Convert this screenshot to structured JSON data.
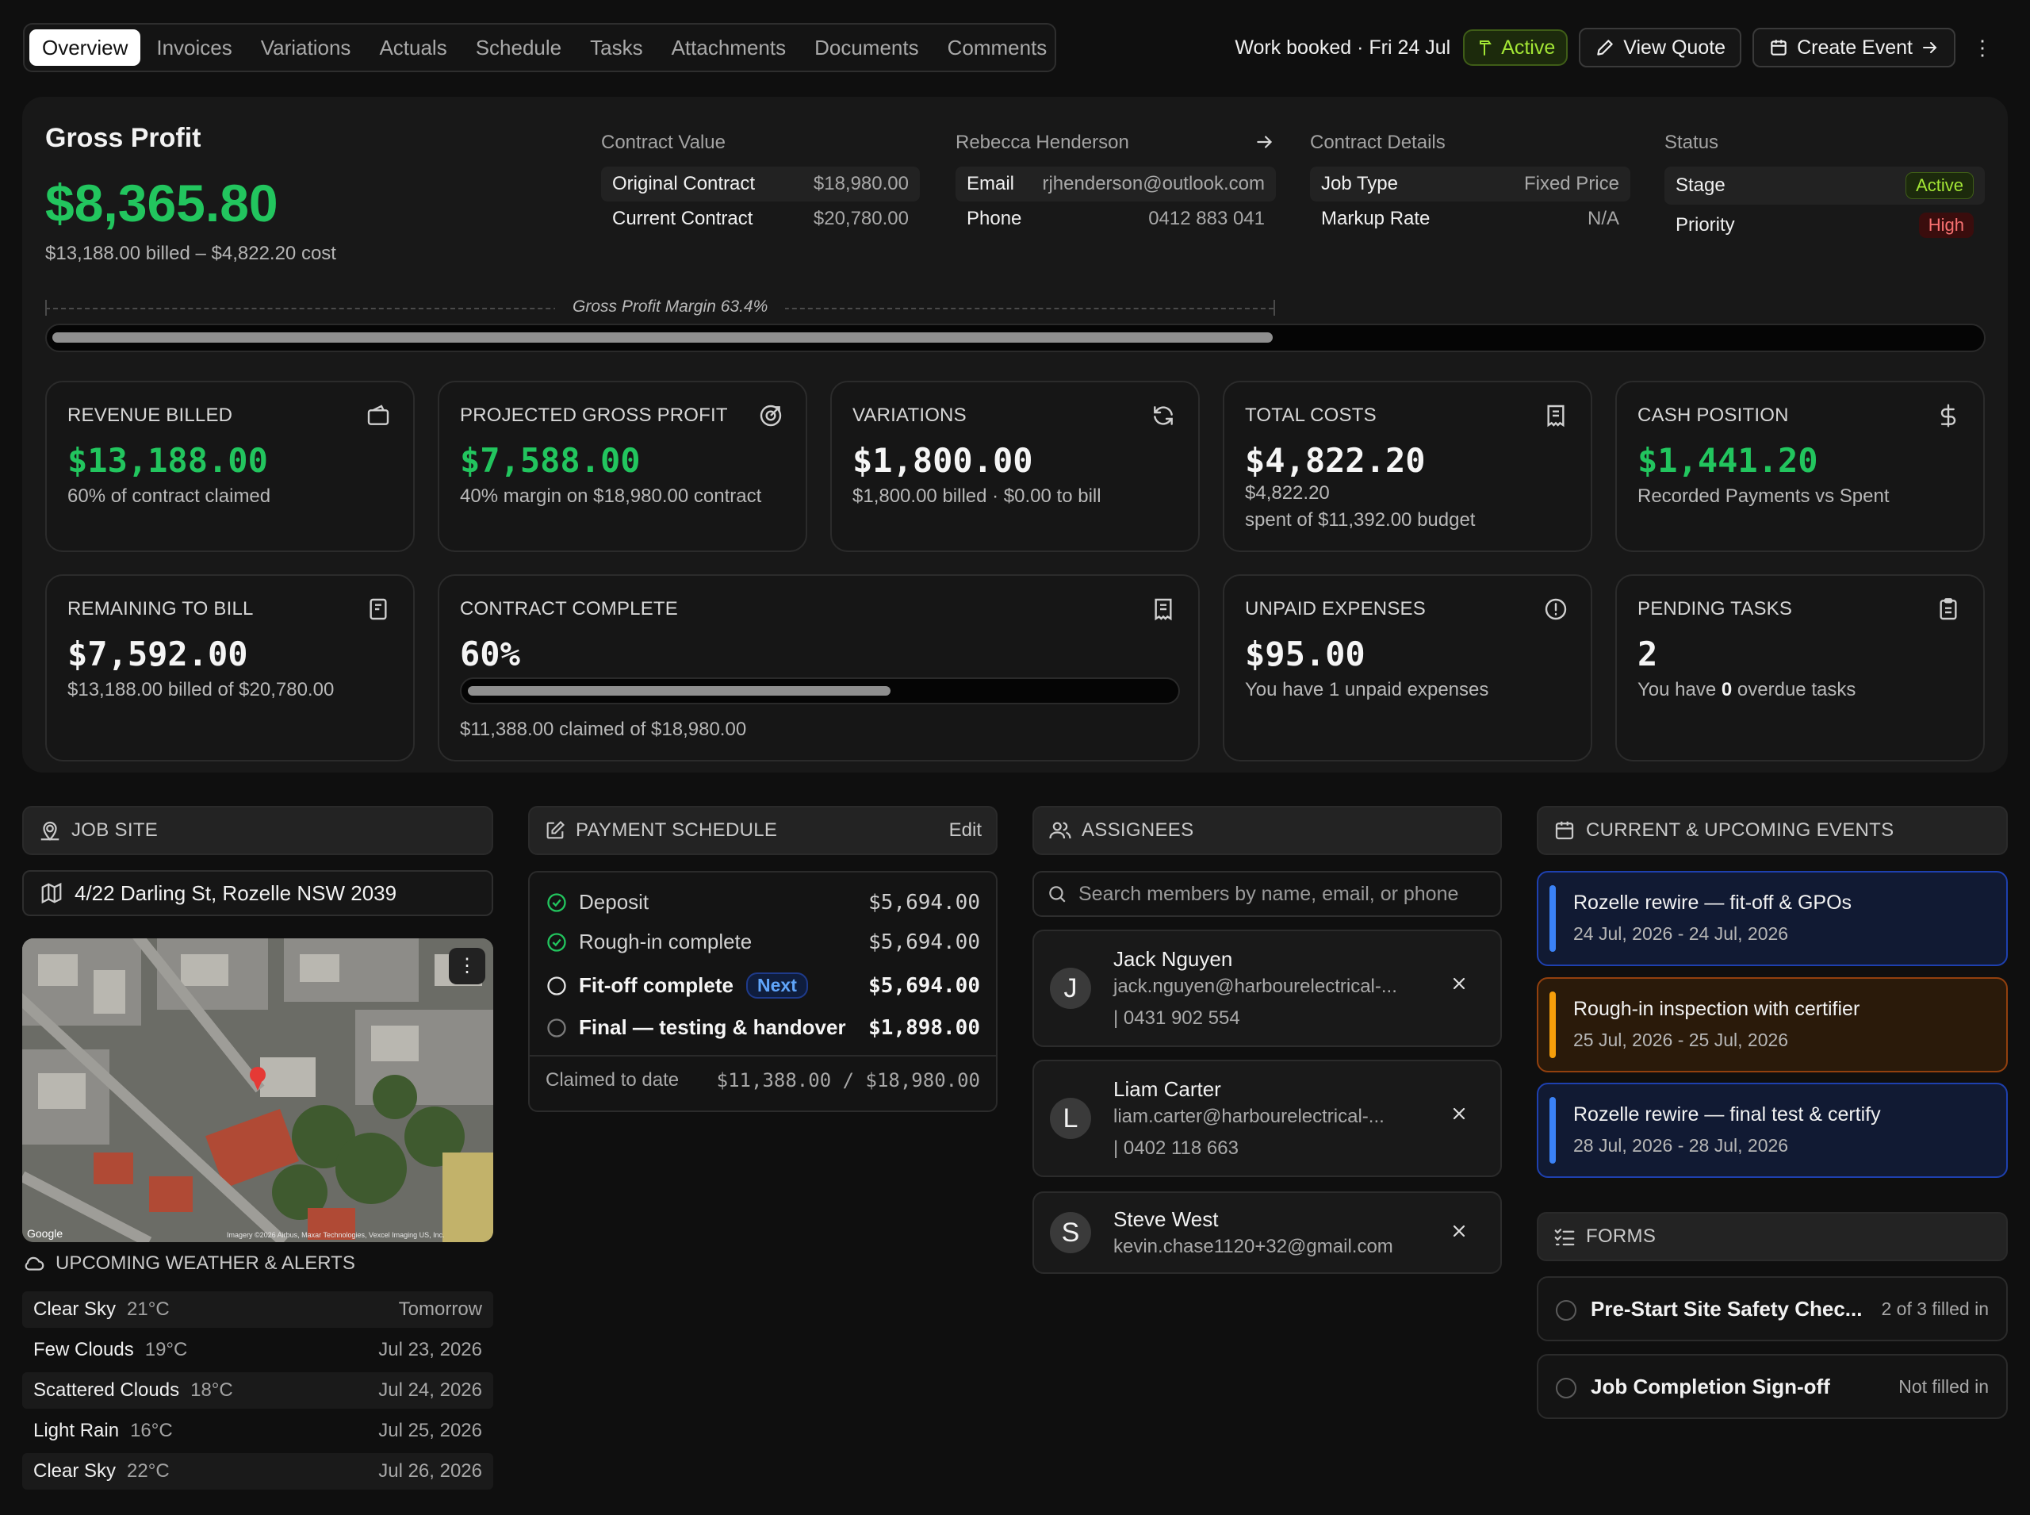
{
  "tabs": [
    "Overview",
    "Invoices",
    "Variations",
    "Actuals",
    "Schedule",
    "Tasks",
    "Attachments",
    "Documents",
    "Comments"
  ],
  "header": {
    "work_booked": "Work booked · Fri 24 Jul",
    "status": "Active",
    "view_quote": "View Quote",
    "create_event": "Create Event",
    "more": "⋮"
  },
  "gross_profit": {
    "title": "Gross Profit",
    "amount": "$8,365.80",
    "sub": "$13,188.00 billed – $4,822.20 cost",
    "margin_label": "Gross Profit Margin 63.4%",
    "margin_fraction": 0.634
  },
  "contract_value": {
    "title": "Contract Value",
    "rows": [
      {
        "k": "Original Contract",
        "v": "$18,980.00"
      },
      {
        "k": "Current Contract",
        "v": "$20,780.00"
      }
    ]
  },
  "client": {
    "name": "Rebecca Henderson",
    "rows": [
      {
        "k": "Email",
        "v": "rjhenderson@outlook.com"
      },
      {
        "k": "Phone",
        "v": "0412 883 041"
      }
    ]
  },
  "contract_details": {
    "title": "Contract Details",
    "rows": [
      {
        "k": "Job Type",
        "v": "Fixed Price"
      },
      {
        "k": "Markup Rate",
        "v": "N/A"
      }
    ]
  },
  "status_block": {
    "title": "Status",
    "stage_label": "Stage",
    "stage": "Active",
    "priority_label": "Priority",
    "priority": "High"
  },
  "stats": {
    "revenue_billed": {
      "label": "REVENUE BILLED",
      "value": "$13,188.00",
      "desc": "60% of contract claimed"
    },
    "projected_gp": {
      "label": "PROJECTED GROSS PROFIT",
      "value": "$7,588.00",
      "desc": "40% margin on $18,980.00 contract"
    },
    "variations": {
      "label": "VARIATIONS",
      "value": "$1,800.00",
      "desc": "$1,800.00 billed · $0.00 to bill"
    },
    "total_costs": {
      "label": "TOTAL COSTS",
      "value": "$4,822.20",
      "sub": "$4,822.20",
      "desc": "spent of $11,392.00 budget"
    },
    "cash_position": {
      "label": "CASH POSITION",
      "value": "$1,441.20",
      "desc": "Recorded Payments vs Spent"
    },
    "remaining": {
      "label": "REMAINING TO BILL",
      "value": "$7,592.00",
      "desc": "$13,188.00 billed of $20,780.00"
    },
    "contract_complete": {
      "label": "CONTRACT COMPLETE",
      "value": "60%",
      "fraction": 0.6,
      "desc": "$11,388.00 claimed of $18,980.00"
    },
    "unpaid": {
      "label": "UNPAID EXPENSES",
      "value": "$95.00",
      "desc": "You have 1 unpaid expenses"
    },
    "pending": {
      "label": "PENDING TASKS",
      "value": "2",
      "desc_a": "You have ",
      "desc_b": "0",
      "desc_c": " overdue tasks"
    }
  },
  "job_site": {
    "title": "JOB SITE",
    "address": "4/22 Darling St, Rozelle NSW 2039",
    "map_brand": "Google",
    "map_credit": "Imagery ©2026 Airbus, Maxar Technologies, Vexcel Imaging US, Inc."
  },
  "weather": {
    "title": "UPCOMING WEATHER & ALERTS",
    "rows": [
      {
        "c": "Clear Sky",
        "t": "21°C",
        "d": "Tomorrow"
      },
      {
        "c": "Few Clouds",
        "t": "19°C",
        "d": "Jul 23, 2026"
      },
      {
        "c": "Scattered Clouds",
        "t": "18°C",
        "d": "Jul 24, 2026"
      },
      {
        "c": "Light Rain",
        "t": "16°C",
        "d": "Jul 25, 2026"
      },
      {
        "c": "Clear Sky",
        "t": "22°C",
        "d": "Jul 26, 2026"
      }
    ]
  },
  "payment": {
    "title": "PAYMENT SCHEDULE",
    "edit": "Edit",
    "rows": [
      {
        "name": "Deposit",
        "amount": "$5,694.00",
        "state": "done"
      },
      {
        "name": "Rough-in complete",
        "amount": "$5,694.00",
        "state": "done"
      },
      {
        "name": "Fit-off complete",
        "amount": "$5,694.00",
        "state": "next",
        "badge": "Next"
      },
      {
        "name": "Final — testing & handover",
        "amount": "$1,898.00",
        "state": "pending"
      }
    ],
    "claimed_label": "Claimed to date",
    "claimed": "$11,388.00 / $18,980.00"
  },
  "assignees": {
    "title": "ASSIGNEES",
    "search_placeholder": "Search members by name, email, or phone",
    "people": [
      {
        "initial": "J",
        "name": "Jack Nguyen",
        "email": "jack.nguyen@harbourelectrical-...",
        "phone": "| 0431 902 554"
      },
      {
        "initial": "L",
        "name": "Liam Carter",
        "email": "liam.carter@harbourelectrical-...",
        "phone": "| 0402 118 663"
      },
      {
        "initial": "S",
        "name": "Steve West",
        "email": "kevin.chase1120+32@gmail.com",
        "phone": ""
      }
    ]
  },
  "events": {
    "title": "CURRENT & UPCOMING EVENTS",
    "items": [
      {
        "title": "Rozelle rewire — fit-off & GPOs",
        "date": "24 Jul, 2026 - 24 Jul, 2026",
        "color": "#3b82f6"
      },
      {
        "title": "Rough-in inspection with certifier",
        "date": "25 Jul, 2026 - 25 Jul, 2026",
        "color": "#f59e0b"
      },
      {
        "title": "Rozelle rewire — final test & certify",
        "date": "28 Jul, 2026 - 28 Jul, 2026",
        "color": "#3b82f6"
      }
    ]
  },
  "forms": {
    "title": "FORMS",
    "items": [
      {
        "name": "Pre-Start Site Safety Chec...",
        "status": "2 of 3 filled in"
      },
      {
        "name": "Job Completion Sign-off",
        "status": "Not filled in"
      }
    ]
  }
}
